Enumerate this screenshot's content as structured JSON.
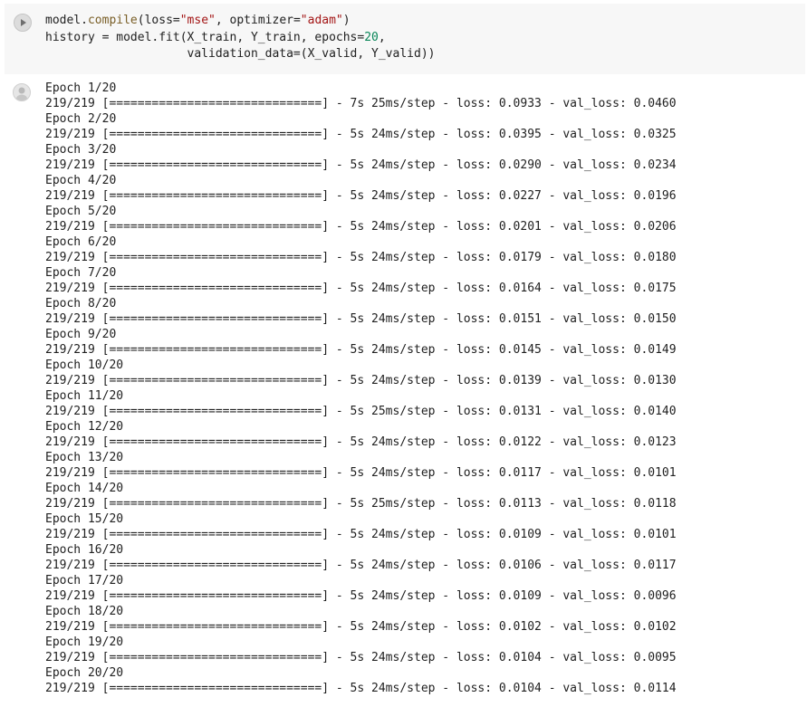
{
  "code_cell": {
    "run_icon": "play-icon",
    "lines": [
      {
        "t1": "model.",
        "fn": "compile",
        "t2": "(loss=",
        "s1": "\"mse\"",
        "t3": ", optimizer=",
        "s2": "\"adam\"",
        "t4": ")"
      },
      {
        "t1": "history = model.fit(X_train, Y_train, epochs=",
        "num": "20",
        "t2": ","
      },
      {
        "t1": "                    validation_data=(X_valid, Y_valid))"
      }
    ]
  },
  "output": {
    "icon": "output-avatar-icon",
    "epochs": [
      {
        "epoch": "Epoch 1/20",
        "log": "219/219 [==============================] - 7s 25ms/step - loss: 0.0933 - val_loss: 0.0460"
      },
      {
        "epoch": "Epoch 2/20",
        "log": "219/219 [==============================] - 5s 24ms/step - loss: 0.0395 - val_loss: 0.0325"
      },
      {
        "epoch": "Epoch 3/20",
        "log": "219/219 [==============================] - 5s 24ms/step - loss: 0.0290 - val_loss: 0.0234"
      },
      {
        "epoch": "Epoch 4/20",
        "log": "219/219 [==============================] - 5s 24ms/step - loss: 0.0227 - val_loss: 0.0196"
      },
      {
        "epoch": "Epoch 5/20",
        "log": "219/219 [==============================] - 5s 24ms/step - loss: 0.0201 - val_loss: 0.0206"
      },
      {
        "epoch": "Epoch 6/20",
        "log": "219/219 [==============================] - 5s 24ms/step - loss: 0.0179 - val_loss: 0.0180"
      },
      {
        "epoch": "Epoch 7/20",
        "log": "219/219 [==============================] - 5s 24ms/step - loss: 0.0164 - val_loss: 0.0175"
      },
      {
        "epoch": "Epoch 8/20",
        "log": "219/219 [==============================] - 5s 24ms/step - loss: 0.0151 - val_loss: 0.0150"
      },
      {
        "epoch": "Epoch 9/20",
        "log": "219/219 [==============================] - 5s 24ms/step - loss: 0.0145 - val_loss: 0.0149"
      },
      {
        "epoch": "Epoch 10/20",
        "log": "219/219 [==============================] - 5s 24ms/step - loss: 0.0139 - val_loss: 0.0130"
      },
      {
        "epoch": "Epoch 11/20",
        "log": "219/219 [==============================] - 5s 25ms/step - loss: 0.0131 - val_loss: 0.0140"
      },
      {
        "epoch": "Epoch 12/20",
        "log": "219/219 [==============================] - 5s 24ms/step - loss: 0.0122 - val_loss: 0.0123"
      },
      {
        "epoch": "Epoch 13/20",
        "log": "219/219 [==============================] - 5s 24ms/step - loss: 0.0117 - val_loss: 0.0101"
      },
      {
        "epoch": "Epoch 14/20",
        "log": "219/219 [==============================] - 5s 25ms/step - loss: 0.0113 - val_loss: 0.0118"
      },
      {
        "epoch": "Epoch 15/20",
        "log": "219/219 [==============================] - 5s 24ms/step - loss: 0.0109 - val_loss: 0.0101"
      },
      {
        "epoch": "Epoch 16/20",
        "log": "219/219 [==============================] - 5s 24ms/step - loss: 0.0106 - val_loss: 0.0117"
      },
      {
        "epoch": "Epoch 17/20",
        "log": "219/219 [==============================] - 5s 24ms/step - loss: 0.0109 - val_loss: 0.0096"
      },
      {
        "epoch": "Epoch 18/20",
        "log": "219/219 [==============================] - 5s 24ms/step - loss: 0.0102 - val_loss: 0.0102"
      },
      {
        "epoch": "Epoch 19/20",
        "log": "219/219 [==============================] - 5s 24ms/step - loss: 0.0104 - val_loss: 0.0095"
      },
      {
        "epoch": "Epoch 20/20",
        "log": "219/219 [==============================] - 5s 24ms/step - loss: 0.0104 - val_loss: 0.0114"
      }
    ]
  }
}
